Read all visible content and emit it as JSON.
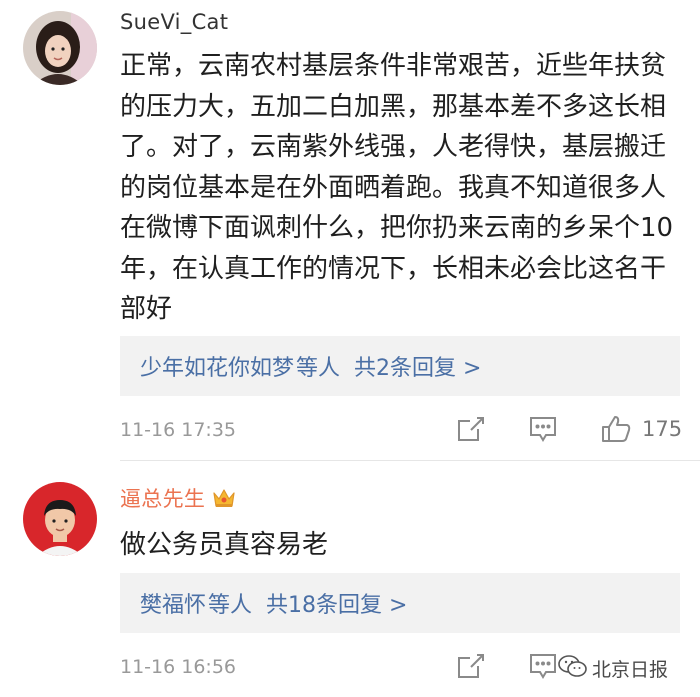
{
  "comments": [
    {
      "username": "SueVi_Cat",
      "text": "正常，云南农村基层条件非常艰苦，近些年扶贫的压力大，五加二白加黑，那基本差不多这长相了。对了，云南紫外线强，人老得快，基层搬迁的岗位基本是在外面晒着跑。我真不知道很多人在微博下面讽刺什么，把你扔来云南的乡呆个10年，在认真工作的情况下，长相未必会比这名干部好",
      "reply_users": "少年如花你如梦",
      "reply_suffix": "等人",
      "reply_count": "共2条回复 >",
      "time": "11-16 17:35",
      "likes": "175"
    },
    {
      "username": "逼总先生",
      "text": "做公务员真容易老",
      "reply_users": "樊福怀",
      "reply_suffix": "等人",
      "reply_count": "共18条回复 >",
      "time": "11-16 16:56"
    }
  ],
  "watermark": "北京日报",
  "colors": {
    "vip_name": "#eb7350",
    "link": "#4a6fa5",
    "reply_bg": "#f2f2f2",
    "meta": "#999999"
  }
}
